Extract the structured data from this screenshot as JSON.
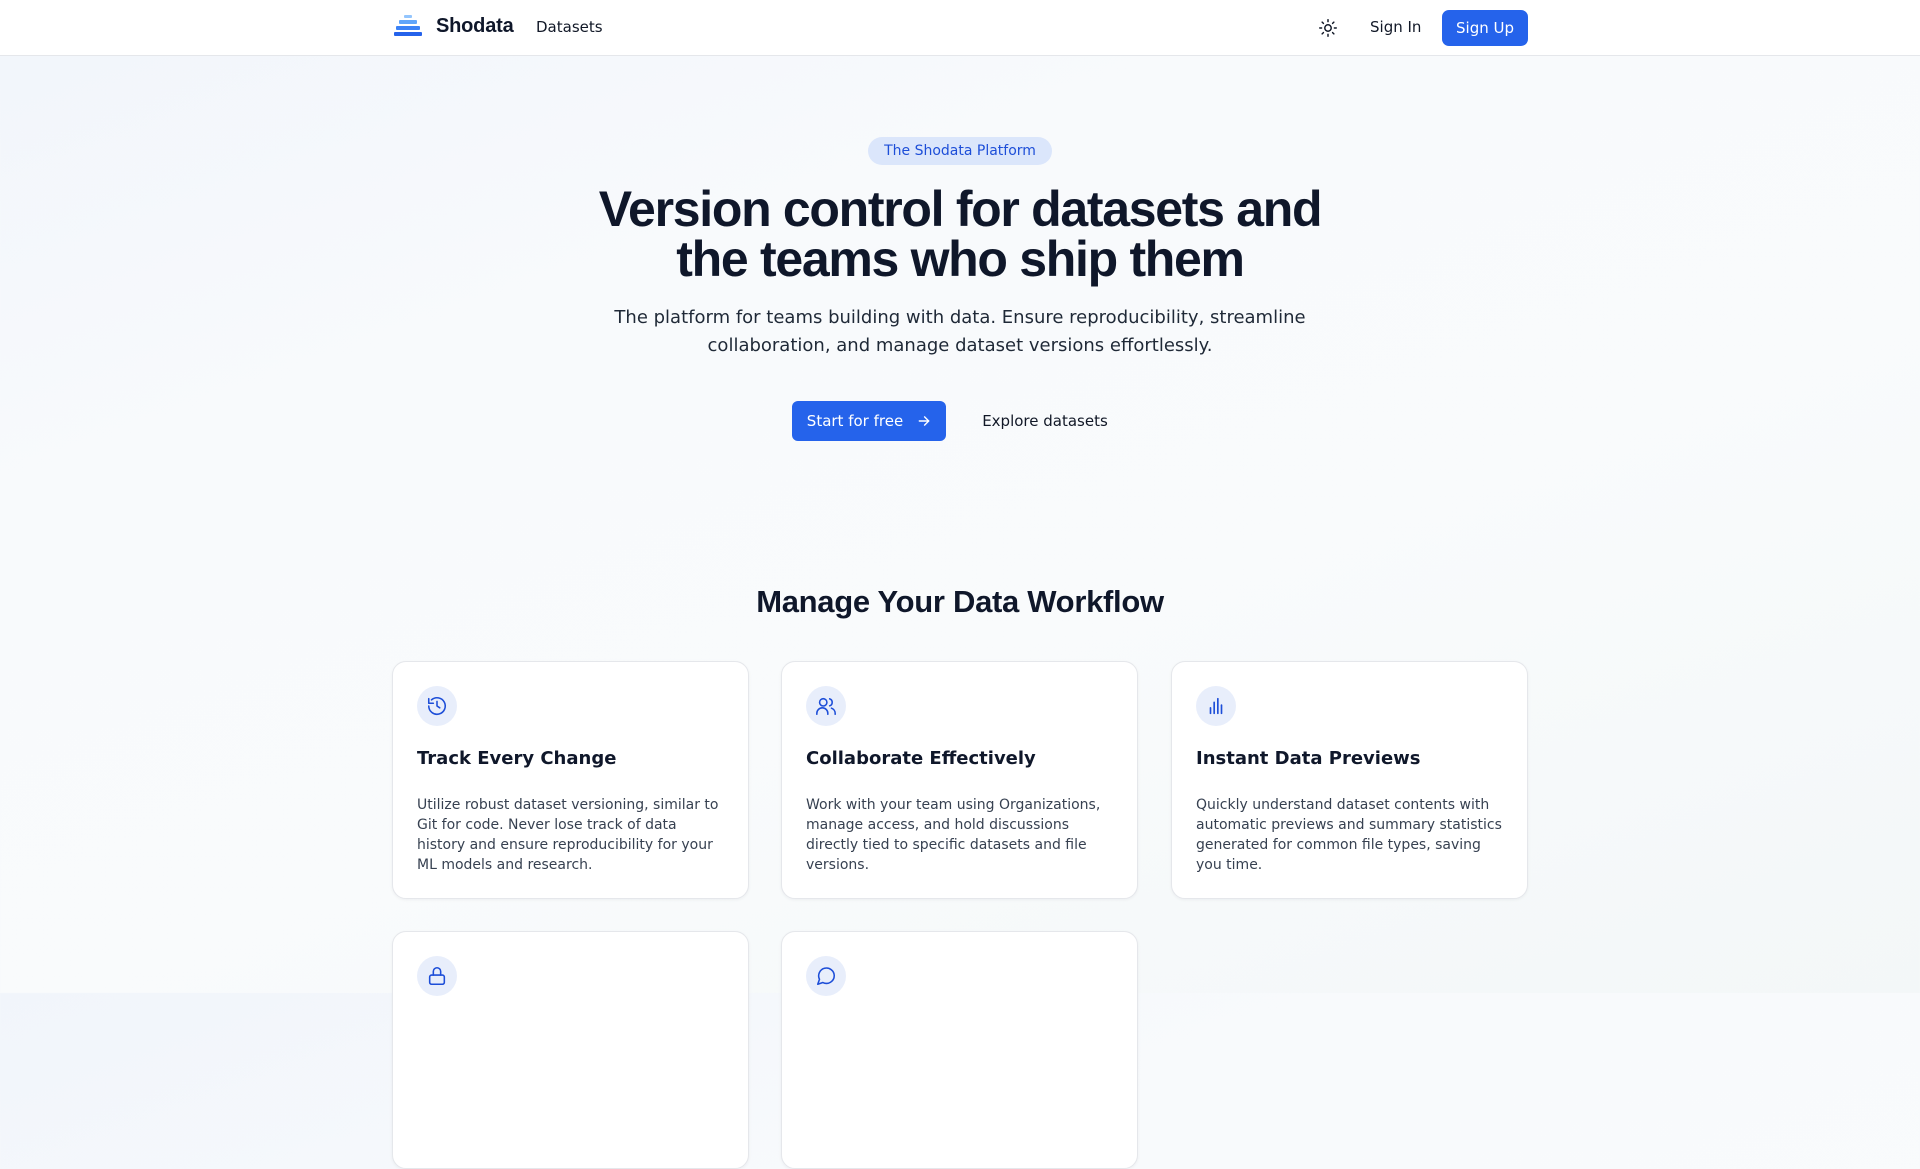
{
  "header": {
    "brand_name": "Shodata",
    "nav_datasets": "Datasets",
    "sign_in": "Sign In",
    "sign_up": "Sign Up"
  },
  "hero": {
    "badge": "The Shodata Platform",
    "title_line1": "Version control for datasets and",
    "title_line2": "the teams who ship them",
    "subtitle_line1": "The platform for teams building with data. Ensure reproducibility, streamline",
    "subtitle_line2": "collaboration, and manage dataset versions effortlessly.",
    "cta_primary": "Start for free",
    "cta_secondary": "Explore datasets"
  },
  "features": {
    "section_title": "Manage Your Data Workflow",
    "cards": [
      {
        "icon": "history-icon",
        "title": "Track Every Change",
        "text": "Utilize robust dataset versioning, similar to Git for code. Never lose track of data history and ensure reproducibility for your ML models and research."
      },
      {
        "icon": "users-icon",
        "title": "Collaborate Effectively",
        "text": "Work with your team using Organizations, manage access, and hold discussions directly tied to specific datasets and file versions."
      },
      {
        "icon": "bar-chart-icon",
        "title": "Instant Data Previews",
        "text": "Quickly understand dataset contents with automatic previews and summary statistics generated for common file types, saving you time."
      },
      {
        "icon": "lock-icon"
      },
      {
        "icon": "message-icon"
      }
    ]
  },
  "colors": {
    "accent": "#2563eb",
    "badge_bg": "#dbe6fb",
    "icon_bg": "#e8eefb"
  }
}
